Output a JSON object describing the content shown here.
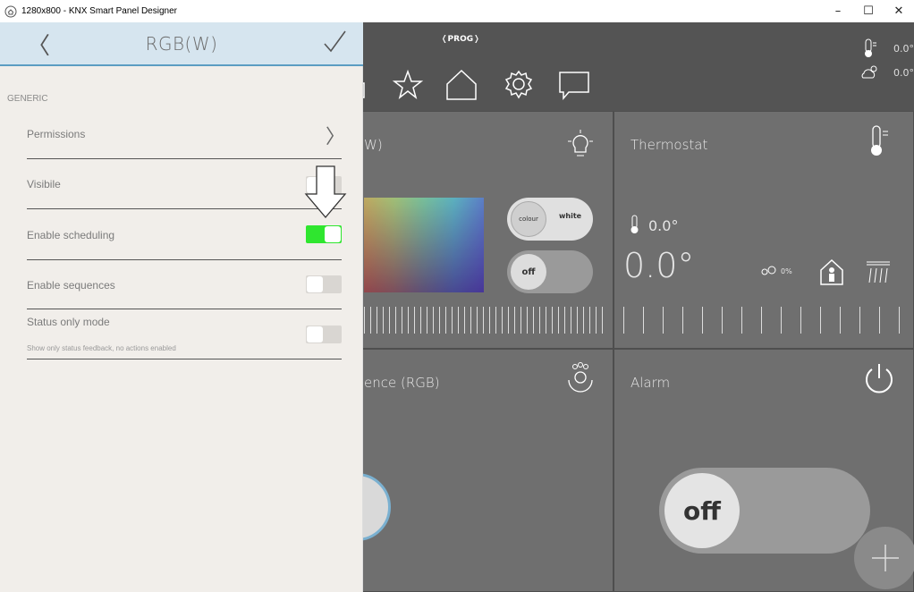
{
  "window": {
    "title": "1280x800 - KNX Smart Panel Designer",
    "minimize": "–",
    "maximize": "☐",
    "close": "✕"
  },
  "app": {
    "prog_label": "❬PROG❭",
    "weather": {
      "indoor_value": "0.0°",
      "outdoor_value": "0.0°"
    },
    "tiles": {
      "rgb_label": "W)",
      "thermostat_label": "Thermostat",
      "thermostat_small_temp": "0.0°",
      "thermostat_big_temp": "0.0°",
      "humidity": "0%",
      "sequence_label": "ence (RGB)",
      "alarm_label": "Alarm",
      "colour_btn": "colour",
      "white_btn": "white",
      "off_btn": "off",
      "alarm_off": "off"
    }
  },
  "panel": {
    "title": "RGB(W)",
    "back": "〈",
    "section": "GENERIC",
    "rows": [
      {
        "label": "Permissions",
        "type": "link"
      },
      {
        "label": "Visibile",
        "type": "toggle",
        "value": false
      },
      {
        "label": "Enable scheduling",
        "type": "toggle",
        "value": true
      },
      {
        "label": "Enable sequences",
        "type": "toggle",
        "value": false
      },
      {
        "label": "Status only mode",
        "type": "toggle",
        "value": false,
        "sublabel": "Show only status feedback, no actions enabled"
      }
    ]
  },
  "colors": {
    "accent": "#5b9dc2",
    "toggle_on": "#2fe62f",
    "panel_bg": "#f1eeea"
  }
}
